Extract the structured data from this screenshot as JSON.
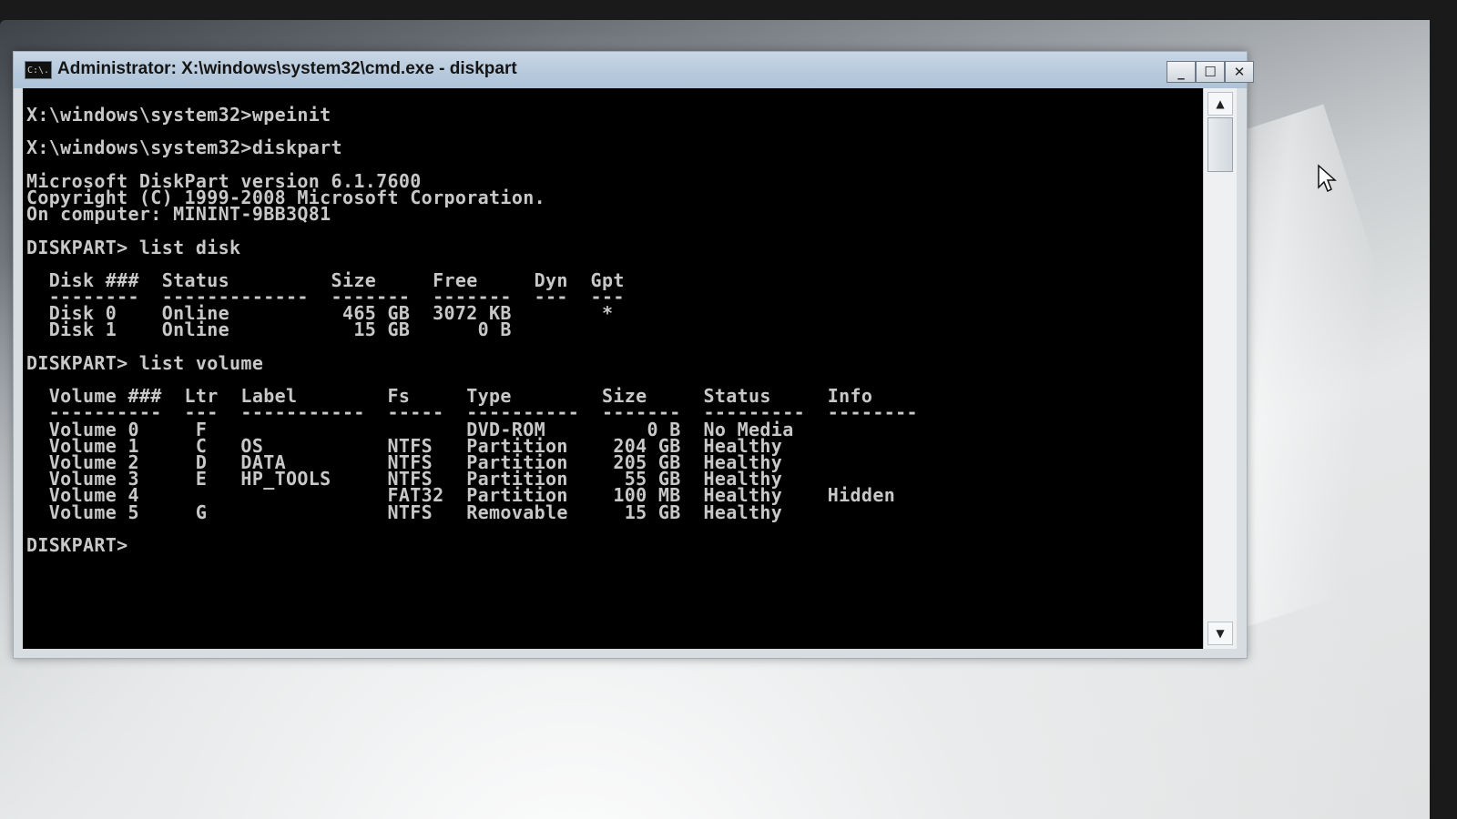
{
  "window": {
    "title": "Administrator: X:\\windows\\system32\\cmd.exe - diskpart",
    "icon_text": "C:\\.",
    "controls": {
      "minimize": "_",
      "maximize": "☐",
      "close": "✕"
    }
  },
  "console": {
    "lines": [
      "X:\\windows\\system32>wpeinit",
      "",
      "X:\\windows\\system32>diskpart",
      "",
      "Microsoft DiskPart version 6.1.7600",
      "Copyright (C) 1999-2008 Microsoft Corporation.",
      "On computer: MININT-9BB3Q81",
      "",
      "DISKPART> list disk",
      "",
      "  Disk ###  Status         Size     Free     Dyn  Gpt",
      "  --------  -------------  -------  -------  ---  ---",
      "  Disk 0    Online          465 GB  3072 KB        *",
      "  Disk 1    Online           15 GB      0 B",
      "",
      "DISKPART> list volume",
      "",
      "  Volume ###  Ltr  Label        Fs     Type        Size     Status     Info",
      "  ----------  ---  -----------  -----  ----------  -------  ---------  --------",
      "  Volume 0     F                       DVD-ROM         0 B  No Media",
      "  Volume 1     C   OS           NTFS   Partition    204 GB  Healthy",
      "  Volume 2     D   DATA         NTFS   Partition    205 GB  Healthy",
      "  Volume 3     E   HP_TOOLS     NTFS   Partition     55 GB  Healthy",
      "  Volume 4                      FAT32  Partition    100 MB  Healthy    Hidden",
      "  Volume 5     G                NTFS   Removable     15 GB  Healthy",
      "",
      "DISKPART> "
    ]
  },
  "scrollbar": {
    "up_arrow": "▲",
    "down_arrow": "▼"
  },
  "icons": [
    "cmd-icon",
    "minimize-icon",
    "maximize-icon",
    "close-icon",
    "scroll-up-icon",
    "scroll-down-icon",
    "mouse-pointer-icon"
  ]
}
